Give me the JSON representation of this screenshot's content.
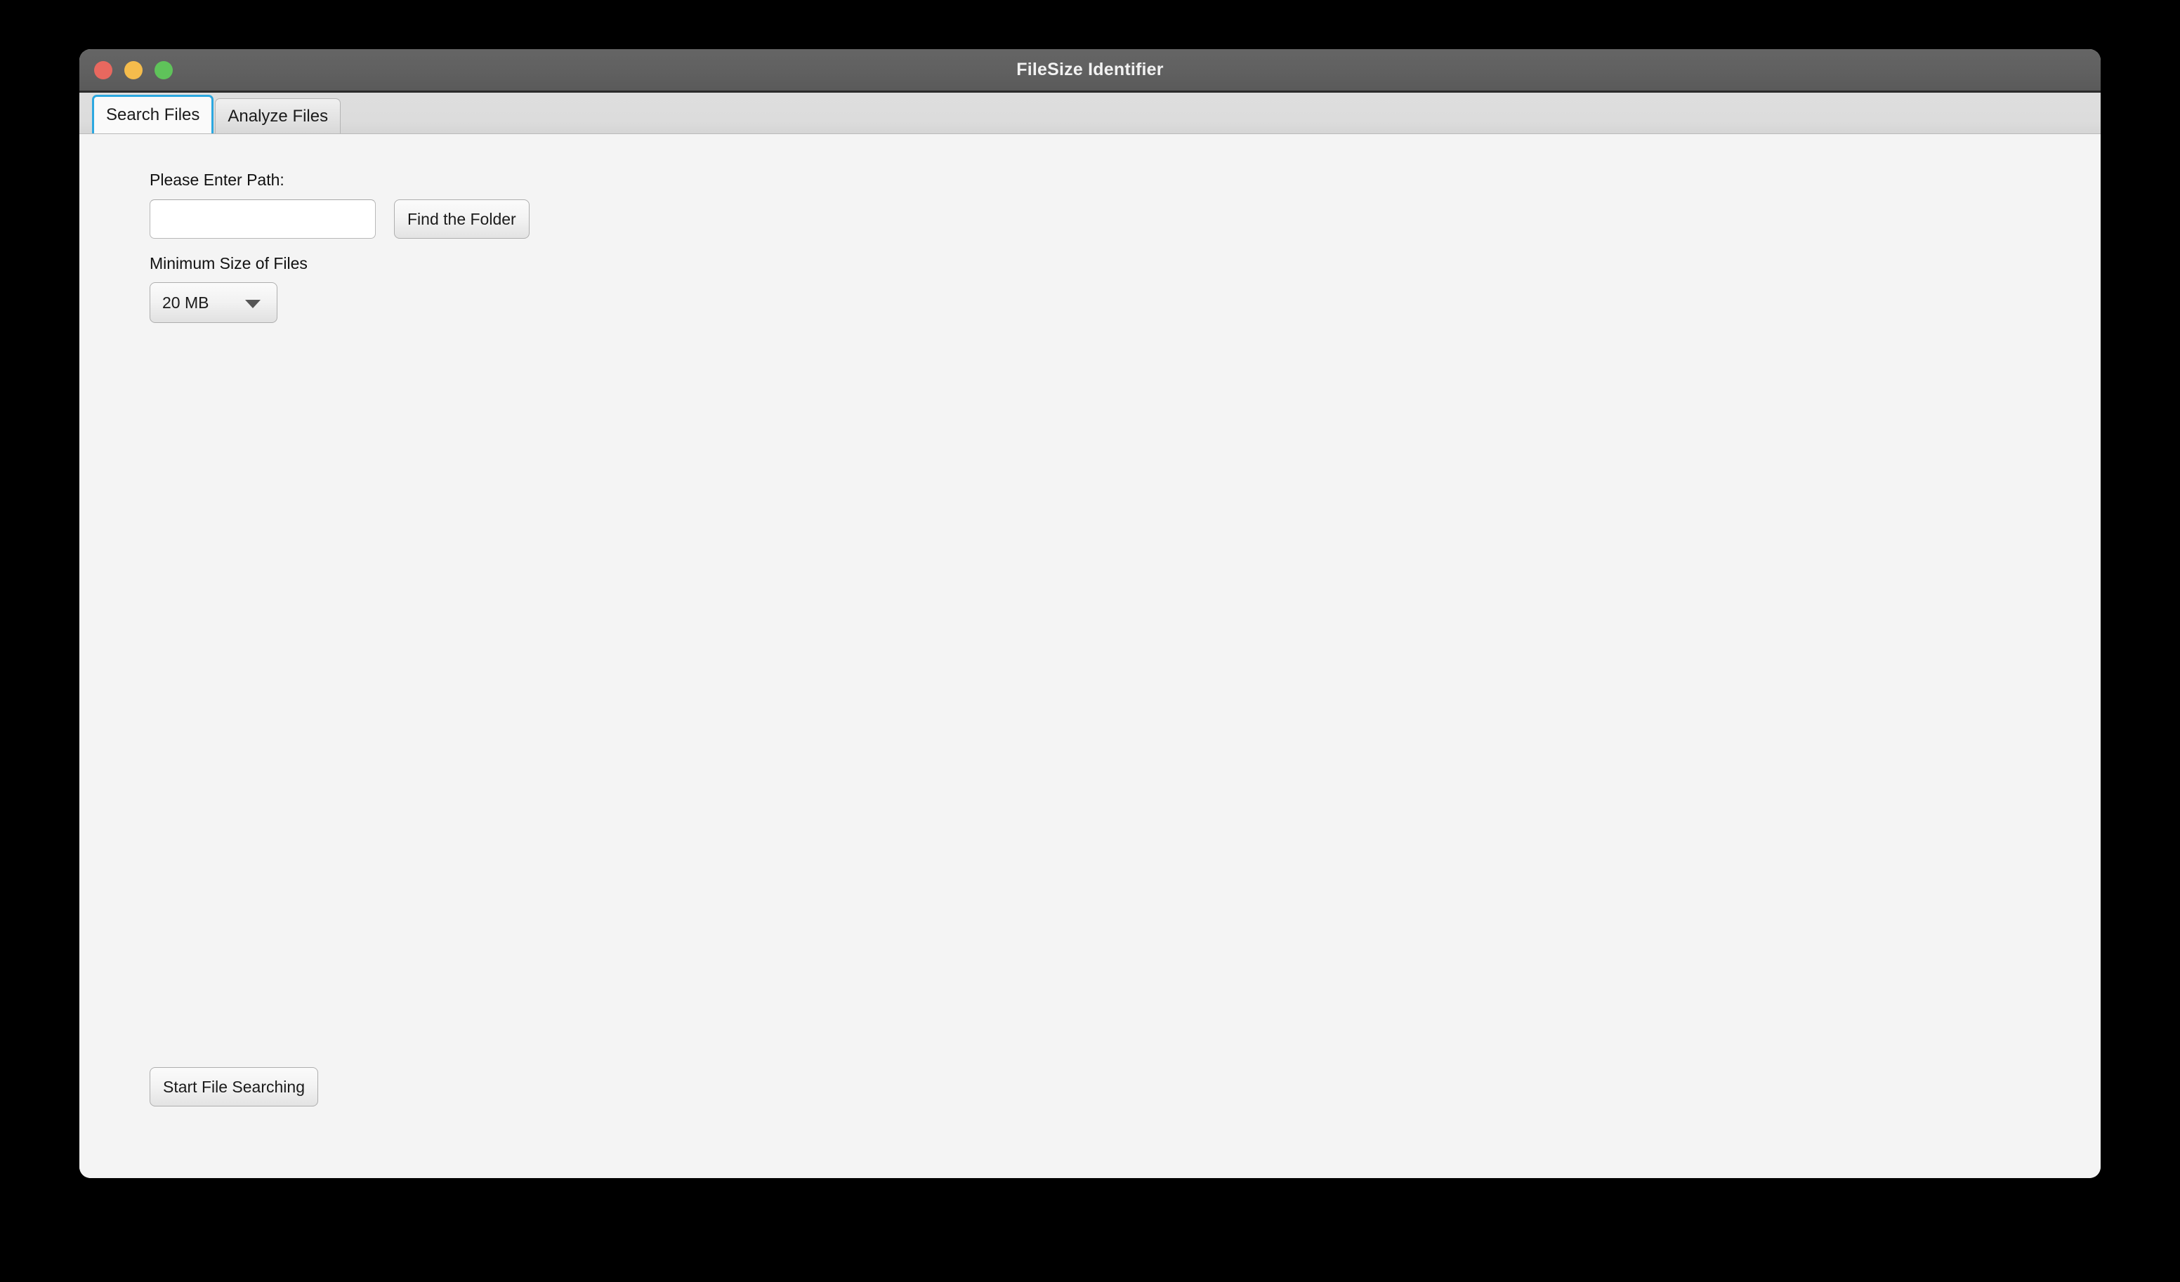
{
  "window": {
    "title": "FileSize Identifier",
    "traffic_lights": [
      {
        "name": "close",
        "color": "#e8685f"
      },
      {
        "name": "minimize",
        "color": "#f5bc4c"
      },
      {
        "name": "maximize",
        "color": "#5fc35a"
      }
    ]
  },
  "tabs": [
    {
      "label": "Search Files",
      "active": true
    },
    {
      "label": "Analyze Files",
      "active": false
    }
  ],
  "search_files": {
    "path_label": "Please Enter Path:",
    "path_value": "",
    "path_placeholder": "",
    "find_folder_label": "Find the Folder",
    "min_size_label": "Minimum Size of Files",
    "min_size_value": "20 MB",
    "min_size_options": [
      "20 MB"
    ],
    "dropdown_icon": "chevron-down-icon",
    "start_search_label": "Start File Searching"
  },
  "colors": {
    "titlebar": "#606060",
    "tabstrip": "#dcdcdc",
    "content": "#f4f4f4",
    "active_tab_border": "#2ca8e0",
    "desktop": "#000000"
  }
}
